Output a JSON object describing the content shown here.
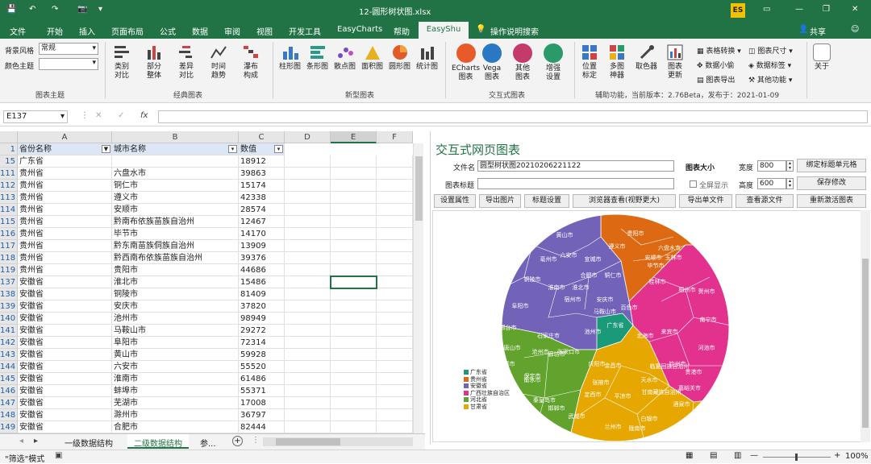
{
  "titlebar": {
    "filename": "12-圆形树状图.xlsx",
    "user": "Shu Ji"
  },
  "menu": [
    "文件",
    "开始",
    "插入",
    "页面布局",
    "公式",
    "数据",
    "审阅",
    "视图",
    "开发工具",
    "EasyCharts",
    "帮助",
    "EasyShu",
    "操作说明搜索"
  ],
  "menu_active": "EasyShu",
  "share": "共享",
  "ribbon": {
    "style_label": "背景风格",
    "style_value": "常规",
    "color_label": "颜色主题",
    "group_theme": "图表主题",
    "group_classic": "经典图表",
    "group_new": "新型图表",
    "group_interactive": "交互式图表",
    "group_aux": "辅助功能，当前版本：2.76Beta，发布于：2021-01-09",
    "classic": [
      "类别\n对比",
      "部分\n整体",
      "差异\n对比",
      "时间\n趋势",
      "瀑布\n构成"
    ],
    "new": [
      "柱形图",
      "条形图",
      "散点图",
      "面积图",
      "圆形图",
      "统计图"
    ],
    "interactive": [
      "ECharts\n图表",
      "Vega\n图表",
      "其他\n图表",
      "增强\n设置"
    ],
    "aux": [
      "位置\n标定",
      "多图\n神器",
      "取色器",
      "图表\n更新"
    ],
    "aux_small": [
      "表格转换",
      "数据小偷",
      "图表导出",
      "图表尺寸",
      "数据标签",
      "其他功能"
    ],
    "about": "关于"
  },
  "formula": {
    "namebox": "E137",
    "fx": "fx"
  },
  "columns": [
    "A",
    "B",
    "C",
    "D",
    "E",
    "F"
  ],
  "header_row": {
    "num": "1",
    "a": "省份名称",
    "b": "城市名称",
    "c": "数值"
  },
  "rows": [
    {
      "n": "15",
      "a": "广东省",
      "b": "",
      "c": "18912"
    },
    {
      "n": "111",
      "a": "贵州省",
      "b": "六盘水市",
      "c": "39863"
    },
    {
      "n": "112",
      "a": "贵州省",
      "b": "铜仁市",
      "c": "15174"
    },
    {
      "n": "113",
      "a": "贵州省",
      "b": "遵义市",
      "c": "42338"
    },
    {
      "n": "114",
      "a": "贵州省",
      "b": "安顺市",
      "c": "28574"
    },
    {
      "n": "115",
      "a": "贵州省",
      "b": "黔南布依族苗族自治州",
      "c": "12467"
    },
    {
      "n": "116",
      "a": "贵州省",
      "b": "毕节市",
      "c": "14170"
    },
    {
      "n": "117",
      "a": "贵州省",
      "b": "黔东南苗族侗族自治州",
      "c": "13909"
    },
    {
      "n": "118",
      "a": "贵州省",
      "b": "黔西南布依族苗族自治州",
      "c": "39376"
    },
    {
      "n": "119",
      "a": "贵州省",
      "b": "贵阳市",
      "c": "44686"
    },
    {
      "n": "137",
      "a": "安徽省",
      "b": "淮北市",
      "c": "15486"
    },
    {
      "n": "138",
      "a": "安徽省",
      "b": "铜陵市",
      "c": "81409"
    },
    {
      "n": "139",
      "a": "安徽省",
      "b": "安庆市",
      "c": "37820"
    },
    {
      "n": "140",
      "a": "安徽省",
      "b": "池州市",
      "c": "98949"
    },
    {
      "n": "141",
      "a": "安徽省",
      "b": "马鞍山市",
      "c": "29272"
    },
    {
      "n": "142",
      "a": "安徽省",
      "b": "阜阳市",
      "c": "72314"
    },
    {
      "n": "143",
      "a": "安徽省",
      "b": "黄山市",
      "c": "59928"
    },
    {
      "n": "144",
      "a": "安徽省",
      "b": "六安市",
      "c": "55520"
    },
    {
      "n": "145",
      "a": "安徽省",
      "b": "淮南市",
      "c": "61486"
    },
    {
      "n": "146",
      "a": "安徽省",
      "b": "蚌埠市",
      "c": "55371"
    },
    {
      "n": "147",
      "a": "安徽省",
      "b": "芜湖市",
      "c": "17008"
    },
    {
      "n": "148",
      "a": "安徽省",
      "b": "滁州市",
      "c": "36797"
    },
    {
      "n": "149",
      "a": "安徽省",
      "b": "合肥市",
      "c": "82444"
    }
  ],
  "sheets": [
    "一级数据结构",
    "二级数据结构",
    "参..."
  ],
  "status": {
    "mode": "\"筛选\"模式",
    "zoom": "100%"
  },
  "panel": {
    "title": "交互式网页图表",
    "file_label": "文件名",
    "file_value": "圆型树状图20210206221122",
    "chart_title_label": "图表标题",
    "size_label": "图表大小",
    "fullscreen": "全屏显示",
    "width_label": "宽度",
    "width_value": "800",
    "height_label": "高度",
    "height_value": "600",
    "bind_btn": "绑定标题单元格",
    "save_btn": "保存修改",
    "buttons": [
      "设置属性",
      "导出图片",
      "标题设置",
      "浏览器查看(视野更大)",
      "导出单文件",
      "查看源文件",
      "重新激活图表"
    ]
  },
  "chart_data": {
    "type": "voronoi-treemap",
    "legend": [
      {
        "name": "广东省",
        "color": "#1a9a78"
      },
      {
        "name": "贵州省",
        "color": "#dd6a12"
      },
      {
        "name": "安徽省",
        "color": "#7263b8"
      },
      {
        "name": "广西壮族自治区",
        "color": "#e3328e"
      },
      {
        "name": "河北省",
        "color": "#62a32e"
      },
      {
        "name": "甘肃省",
        "color": "#e6a800"
      }
    ],
    "labels": {
      "贵州省": [
        "铜仁市",
        "毕节市",
        "贵阳市",
        "遵义市",
        "六盘水市",
        "安顺市"
      ],
      "安徽省": [
        "池州市",
        "黄山市",
        "亳州市",
        "六安市",
        "阜阳市",
        "淮南市",
        "合肥市",
        "宣城市",
        "铜陵市",
        "淮北市",
        "安庆市",
        "马鞍山市",
        "宿州市"
      ],
      "广西壮族自治区": [
        "玉林市",
        "桂林市",
        "梧州市",
        "贺州市",
        "南宁市",
        "百色市",
        "北海市",
        "来宾市",
        "河池市",
        "钦州市",
        "贵港市"
      ],
      "河北省": [
        "沧州市",
        "邢台市",
        "石家庄市",
        "廊坊市",
        "衡水市",
        "承德市",
        "保定市",
        "张家口市",
        "唐山市",
        "秦皇岛市",
        "邯郸市"
      ],
      "甘肃省": [
        "平凉市",
        "庆阳市",
        "金昌市",
        "定西市",
        "张掖市",
        "天水市",
        "白银市",
        "武威市",
        "兰州市",
        "陇南市",
        "嘉峪关市",
        "酒泉市",
        "临夏回族自治州",
        "甘南藏族自治州"
      ],
      "广东省": [
        "广东省"
      ]
    }
  }
}
